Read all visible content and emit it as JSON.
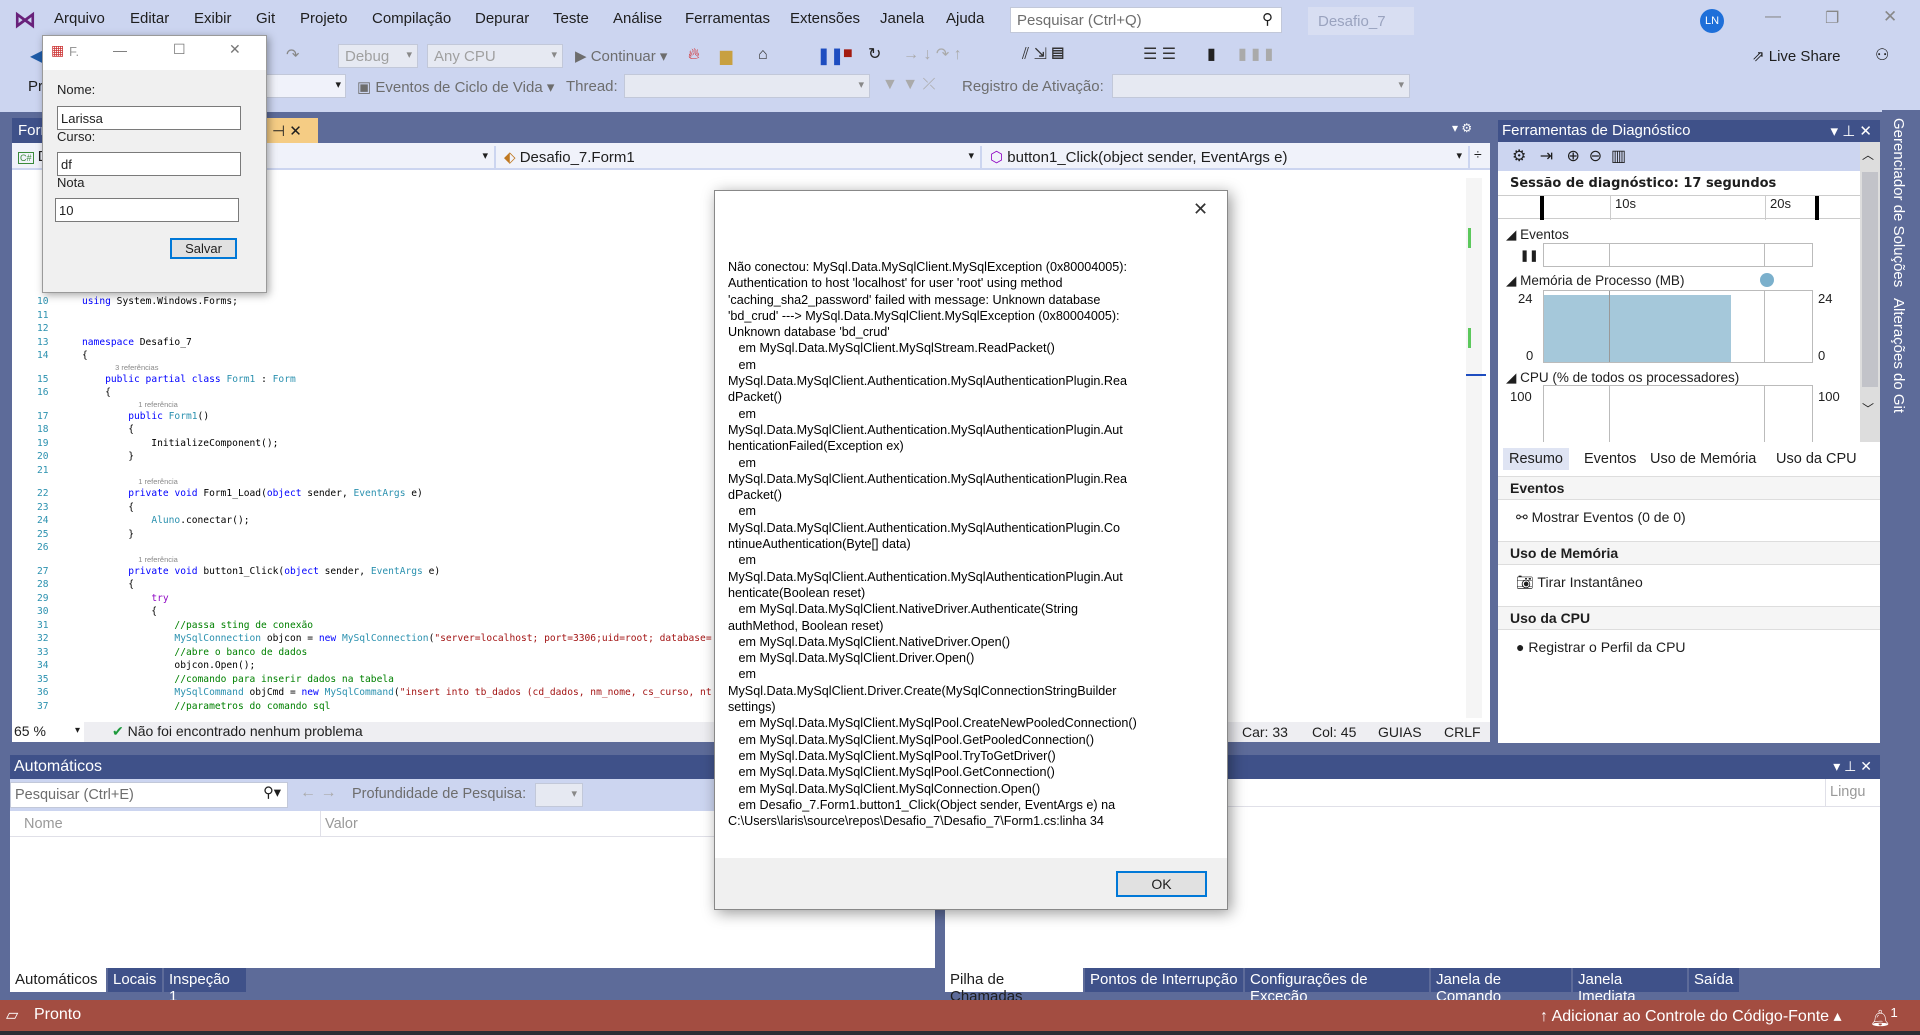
{
  "menu": [
    "Arquivo",
    "Editar",
    "Exibir",
    "Git",
    "Projeto",
    "Compilação",
    "Depurar",
    "Teste",
    "Análise",
    "Ferramentas",
    "Extensões",
    "Janela",
    "Ajuda"
  ],
  "search": {
    "placeholder": "Pesquisar (Ctrl+Q)"
  },
  "solution_name": "Desafio_7",
  "user_initials": "LN",
  "toolbar": {
    "config": "Debug",
    "platform": "Any CPU",
    "continue": "Continuar",
    "live_share": "Live Share",
    "process_label": "Pr",
    "lifecycle": "Eventos de Ciclo de Vida",
    "thread": "Thread:",
    "stack_frame": "Registro de Ativação:"
  },
  "doc_tab": {
    "label": "Forr"
  },
  "nav": {
    "project": "D",
    "class": "Desafio_7.Form1",
    "member": "button1_Click(object sender, EventArgs e)"
  },
  "code": [
    {
      "n": "10",
      "seg": [
        [
          "using",
          "k"
        ],
        [
          " System.Windows.Forms;",
          "n"
        ]
      ]
    },
    {
      "n": "11",
      "seg": []
    },
    {
      "n": "12",
      "seg": []
    },
    {
      "n": "13",
      "seg": [
        [
          "namespace",
          "k"
        ],
        [
          " Desafio_7",
          "n"
        ]
      ]
    },
    {
      "n": "14",
      "seg": [
        [
          "{",
          "n"
        ]
      ]
    },
    {
      "ref": "3 referências",
      "indent": 4
    },
    {
      "n": "15",
      "seg": [
        [
          "    ",
          "n"
        ],
        [
          "public",
          "k"
        ],
        [
          " ",
          "n"
        ],
        [
          "partial",
          "k"
        ],
        [
          " ",
          "n"
        ],
        [
          "class",
          "k"
        ],
        [
          " ",
          "n"
        ],
        [
          "Form1",
          "t"
        ],
        [
          " : ",
          "n"
        ],
        [
          "Form",
          "t"
        ]
      ]
    },
    {
      "n": "16",
      "seg": [
        [
          "    {",
          "n"
        ]
      ]
    },
    {
      "ref": "1 referência",
      "indent": 8
    },
    {
      "n": "17",
      "seg": [
        [
          "        ",
          "n"
        ],
        [
          "public",
          "k"
        ],
        [
          " ",
          "n"
        ],
        [
          "Form1",
          "t"
        ],
        [
          "()",
          "n"
        ]
      ]
    },
    {
      "n": "18",
      "seg": [
        [
          "        {",
          "n"
        ]
      ]
    },
    {
      "n": "19",
      "seg": [
        [
          "            InitializeComponent();",
          "n"
        ]
      ]
    },
    {
      "n": "20",
      "seg": [
        [
          "        }",
          "n"
        ]
      ]
    },
    {
      "n": "21",
      "seg": []
    },
    {
      "ref": "1 referência",
      "indent": 8
    },
    {
      "n": "22",
      "seg": [
        [
          "        ",
          "n"
        ],
        [
          "private",
          "k"
        ],
        [
          " ",
          "n"
        ],
        [
          "void",
          "k"
        ],
        [
          " Form1_Load(",
          "n"
        ],
        [
          "object",
          "k"
        ],
        [
          " sender, ",
          "n"
        ],
        [
          "EventArgs",
          "t"
        ],
        [
          " e)",
          "n"
        ]
      ]
    },
    {
      "n": "23",
      "seg": [
        [
          "        {",
          "n"
        ]
      ]
    },
    {
      "n": "24",
      "seg": [
        [
          "            ",
          "n"
        ],
        [
          "Aluno",
          "t"
        ],
        [
          ".conectar();",
          "n"
        ]
      ]
    },
    {
      "n": "25",
      "seg": [
        [
          "        }",
          "n"
        ]
      ]
    },
    {
      "n": "26",
      "seg": []
    },
    {
      "ref": "1 referência",
      "indent": 8
    },
    {
      "n": "27",
      "seg": [
        [
          "        ",
          "n"
        ],
        [
          "private",
          "k"
        ],
        [
          " ",
          "n"
        ],
        [
          "void",
          "k"
        ],
        [
          " button1_Click(",
          "n"
        ],
        [
          "object",
          "k"
        ],
        [
          " sender, ",
          "n"
        ],
        [
          "EventArgs",
          "t"
        ],
        [
          " e)",
          "n"
        ]
      ]
    },
    {
      "n": "28",
      "seg": [
        [
          "        {",
          "n"
        ]
      ]
    },
    {
      "n": "29",
      "seg": [
        [
          "            ",
          "n"
        ],
        [
          "try",
          "p"
        ]
      ]
    },
    {
      "n": "30",
      "seg": [
        [
          "            {",
          "n"
        ]
      ]
    },
    {
      "n": "31",
      "seg": [
        [
          "                ",
          "n"
        ],
        [
          "//passa sting de conexão",
          "c"
        ]
      ]
    },
    {
      "n": "32",
      "seg": [
        [
          "                ",
          "n"
        ],
        [
          "MySqlConnection",
          "t"
        ],
        [
          " objcon = ",
          "n"
        ],
        [
          "new",
          "k"
        ],
        [
          " ",
          "n"
        ],
        [
          "MySqlConnection",
          "t"
        ],
        [
          "(",
          "n"
        ],
        [
          "\"server=localhost; port=3306;uid=root; database=",
          "s"
        ]
      ]
    },
    {
      "n": "33",
      "seg": [
        [
          "                ",
          "n"
        ],
        [
          "//abre o banco de dados",
          "c"
        ]
      ]
    },
    {
      "n": "34",
      "seg": [
        [
          "                objcon.Open();",
          "n"
        ]
      ]
    },
    {
      "n": "35",
      "seg": [
        [
          "                ",
          "n"
        ],
        [
          "//comando para inserir dados na tabela",
          "c"
        ]
      ]
    },
    {
      "n": "36",
      "seg": [
        [
          "                ",
          "n"
        ],
        [
          "MySqlCommand",
          "t"
        ],
        [
          " objCmd = ",
          "n"
        ],
        [
          "new",
          "k"
        ],
        [
          " ",
          "n"
        ],
        [
          "MySqlCommand",
          "t"
        ],
        [
          "(",
          "n"
        ],
        [
          "\"insert into tb_dados (cd_dados, nm_nome, cs_curso, nt",
          "s"
        ]
      ]
    },
    {
      "n": "37",
      "seg": [
        [
          "                ",
          "n"
        ],
        [
          "//parametros do comando sql",
          "c"
        ]
      ]
    }
  ],
  "editor_status": {
    "zoom": "65 %",
    "problems": "Não foi encontrado nenhum problema",
    "line": "Car: 33",
    "col": "Col: 45",
    "tabs": "GUIAS",
    "eol": "CRLF"
  },
  "diagnostics": {
    "title": "Ferramentas de Diagnóstico",
    "session": "Sessão de diagnóstico: 17 segundos",
    "ticks": [
      "10s",
      "20s"
    ],
    "events_label": "Eventos",
    "memory_label": "Memória de Processo (MB)",
    "memory_max": "24",
    "memory_min": "0",
    "memory_level_mb": 22.5,
    "cpu_label": "CPU (% de todos os processadores)",
    "cpu_max": "100",
    "tabs": [
      "Resumo",
      "Eventos",
      "Uso de Memória",
      "Uso da CPU"
    ],
    "sections": [
      {
        "header": "Eventos",
        "action": "Mostrar Eventos (0 de 0)"
      },
      {
        "header": "Uso de Memória",
        "action": "Tirar Instantâneo"
      },
      {
        "header": "Uso da CPU",
        "action": "Registrar o Perfil da CPU"
      }
    ],
    "memory_color": "#a5c8da"
  },
  "side_tabs": [
    "Gerenciador de Soluções",
    "Alterações do Git"
  ],
  "autos": {
    "title": "Automáticos",
    "search_placeholder": "Pesquisar (Ctrl+E)",
    "depth": "Profundidade de Pesquisa:",
    "col_name": "Nome",
    "col_value": "Valor"
  },
  "right_panel": {
    "col_lang": "Lingu"
  },
  "bottom_tabs_left": [
    "Automáticos",
    "Locais",
    "Inspeção 1"
  ],
  "bottom_tabs_right": [
    "Pilha de Chamadas",
    "Pontos de Interrupção",
    "Configurações de Exceção",
    "Janela de Comando",
    "Janela Imediata",
    "Saída"
  ],
  "status": {
    "text": "Pronto",
    "source_control": "Adicionar ao Controle do Código-Fonte",
    "notifications": "1",
    "color": "#a34d41"
  },
  "form": {
    "title": "F.",
    "nome_label": "Nome:",
    "nome": "Larissa",
    "curso_label": "Curso:",
    "curso": "df",
    "nota_label": "Nota",
    "nota": "10",
    "save": "Salvar"
  },
  "dialog": {
    "message": "Não conectou: MySql.Data.MySqlClient.MySqlException (0x80004005):\nAuthentication to host 'localhost' for user 'root' using method\n'caching_sha2_password' failed with message: Unknown database\n'bd_crud' ---> MySql.Data.MySqlClient.MySqlException (0x80004005):\nUnknown database 'bd_crud'\n   em MySql.Data.MySqlClient.MySqlStream.ReadPacket()\n   em\nMySql.Data.MySqlClient.Authentication.MySqlAuthenticationPlugin.Rea\ndPacket()\n   em\nMySql.Data.MySqlClient.Authentication.MySqlAuthenticationPlugin.Aut\nhenticationFailed(Exception ex)\n   em\nMySql.Data.MySqlClient.Authentication.MySqlAuthenticationPlugin.Rea\ndPacket()\n   em\nMySql.Data.MySqlClient.Authentication.MySqlAuthenticationPlugin.Co\nntinueAuthentication(Byte[] data)\n   em\nMySql.Data.MySqlClient.Authentication.MySqlAuthenticationPlugin.Aut\nhenticate(Boolean reset)\n   em MySql.Data.MySqlClient.NativeDriver.Authenticate(String\nauthMethod, Boolean reset)\n   em MySql.Data.MySqlClient.NativeDriver.Open()\n   em MySql.Data.MySqlClient.Driver.Open()\n   em\nMySql.Data.MySqlClient.Driver.Create(MySqlConnectionStringBuilder\nsettings)\n   em MySql.Data.MySqlClient.MySqlPool.CreateNewPooledConnection()\n   em MySql.Data.MySqlClient.MySqlPool.GetPooledConnection()\n   em MySql.Data.MySqlClient.MySqlPool.TryToGetDriver()\n   em MySql.Data.MySqlClient.MySqlPool.GetConnection()\n   em MySql.Data.MySqlClient.MySqlConnection.Open()\n   em Desafio_7.Form1.button1_Click(Object sender, EventArgs e) na\nC:\\Users\\laris\\source\\repos\\Desafio_7\\Desafio_7\\Form1.cs:linha 34",
    "ok": "OK"
  }
}
